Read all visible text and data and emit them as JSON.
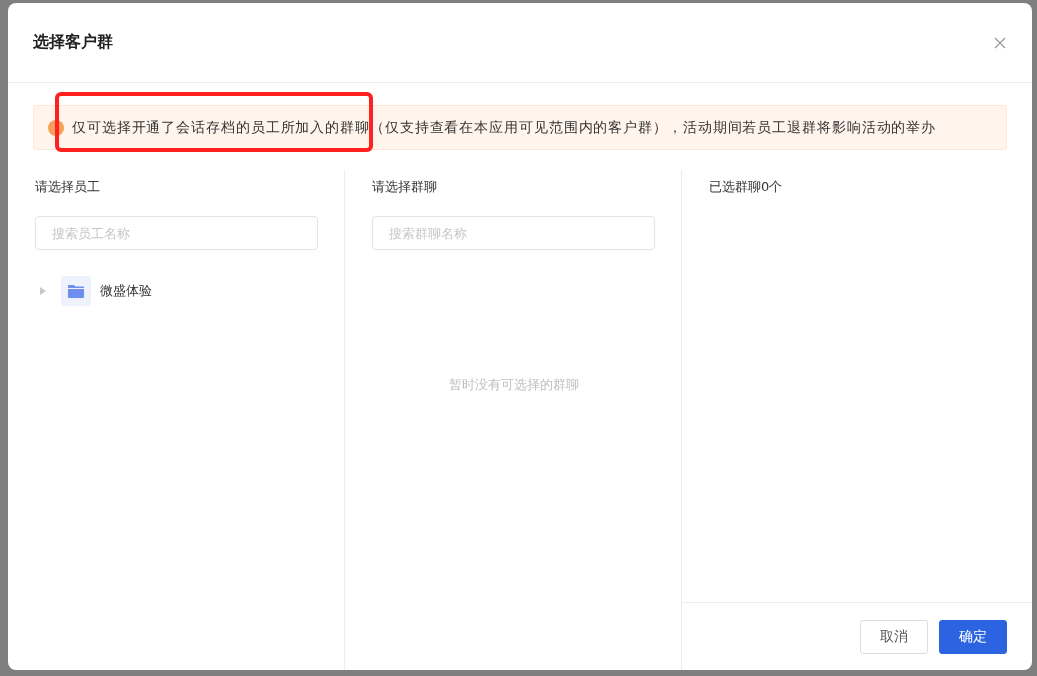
{
  "dialog": {
    "title": "选择客户群"
  },
  "notice": "仅可选择开通了会话存档的员工所加入的群聊（仅支持查看在本应用可见范围内的客户群），活动期间若员工退群将影响活动的举办",
  "employees": {
    "title": "请选择员工",
    "search": {
      "placeholder": "搜索员工名称"
    },
    "tree": [
      {
        "label": "微盛体验",
        "expanded": false
      }
    ]
  },
  "groups": {
    "title": "请选择群聊",
    "search": {
      "placeholder": "搜索群聊名称"
    },
    "empty": "暂时没有可选择的群聊"
  },
  "selected": {
    "title": "已选群聊0个"
  },
  "buttons": [
    {
      "label": "取消",
      "kind": "secondary"
    },
    {
      "label": "确定",
      "kind": "primary"
    }
  ]
}
